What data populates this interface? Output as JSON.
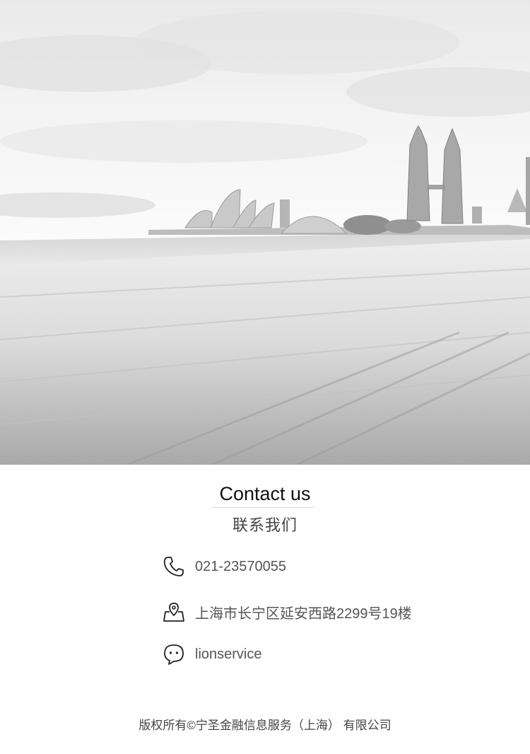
{
  "hero": {
    "image_description_icon": "city-skyline-banner"
  },
  "contact": {
    "title": "Contact us",
    "subtitle": "联系我们",
    "phone": {
      "icon": "phone-icon",
      "text": "021-23570055"
    },
    "address": {
      "icon": "map-pin-icon",
      "text": "上海市长宁区延安西路2299号19楼"
    },
    "wechat": {
      "icon": "chat-bubble-icon",
      "text": "lionservice"
    }
  },
  "footer": {
    "copyright": "版权所有©宁圣金融信息服务（上海） 有限公司"
  },
  "colors": {
    "background": "#ffffff",
    "title": "#111111",
    "text": "#555555"
  }
}
